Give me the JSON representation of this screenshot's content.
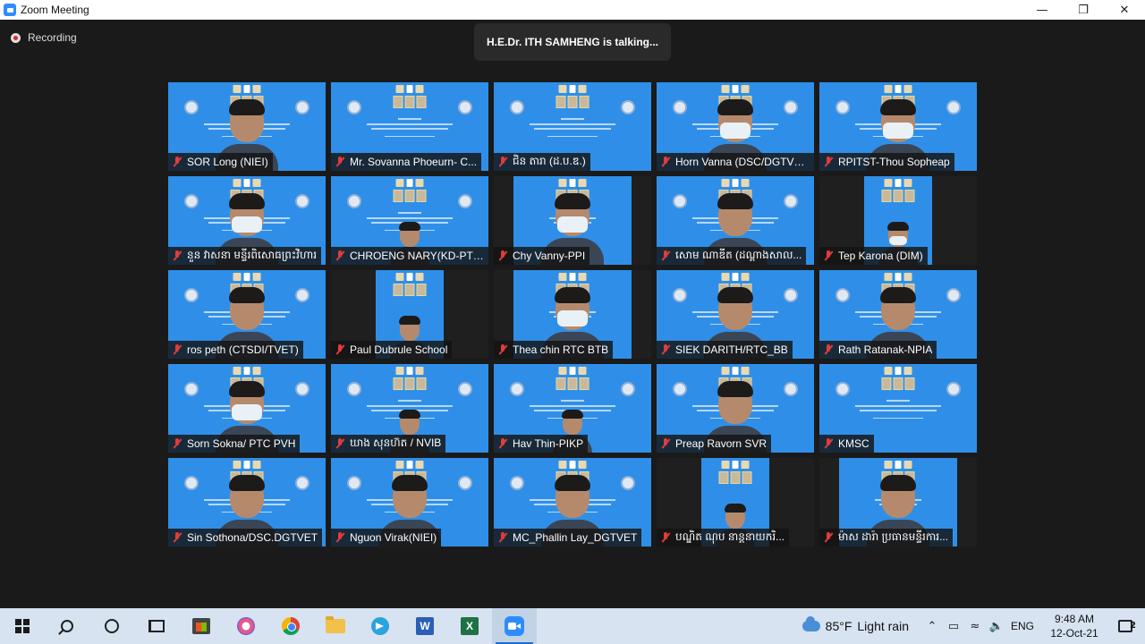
{
  "window": {
    "title": "Zoom Meeting",
    "controls": [
      "minimize-icon",
      "maximize-icon",
      "close-icon"
    ]
  },
  "recording": {
    "label": "Recording"
  },
  "speaker": {
    "text": "H.E.Dr. ITH SAMHENG is talking..."
  },
  "participants": [
    {
      "name": "SOR Long (NIEI)",
      "layout": "full",
      "person": "normal"
    },
    {
      "name": "Mr. Sovanna Phoeurn- C...",
      "layout": "full",
      "person": "none"
    },
    {
      "name": "ជិន តារា (ដ.ប.ឌ.)",
      "layout": "full",
      "person": "none"
    },
    {
      "name": "Horn Vanna (DSC/DGTVET)",
      "layout": "full",
      "person": "mask"
    },
    {
      "name": "RPITST-Thou Sopheap",
      "layout": "full",
      "person": "mask"
    },
    {
      "name": "នួន វាសនា មន្ទីរពិសោធព្រះវិហារ",
      "layout": "full",
      "person": "mask"
    },
    {
      "name": "CHROENG NARY(KD-PTC...",
      "layout": "full",
      "person": "small"
    },
    {
      "name": "Chy Vanny-PPI",
      "layout": "mid",
      "person": "mask"
    },
    {
      "name": "សោម ណាឌីត (ដណ្ដាងសាល...",
      "layout": "full",
      "person": "normal"
    },
    {
      "name": "Tep Karona (DIM)",
      "layout": "narrow",
      "person": "mask-small"
    },
    {
      "name": "ros peth (CTSDI/TVET)",
      "layout": "full",
      "person": "normal"
    },
    {
      "name": "Paul Dubrule School",
      "layout": "narrow",
      "person": "small"
    },
    {
      "name": "Thea chin RTC BTB",
      "layout": "mid",
      "person": "mask"
    },
    {
      "name": "SIEK DARITH/RTC_BB",
      "layout": "full",
      "person": "normal"
    },
    {
      "name": "Rath Ratanak-NPIA",
      "layout": "full",
      "person": "normal"
    },
    {
      "name": "Sorn Sokna/ PTC PVH",
      "layout": "full",
      "person": "mask"
    },
    {
      "name": "ឃាង សុនហ៊ត / NVIB",
      "layout": "full",
      "person": "small"
    },
    {
      "name": "Hav Thin-PIKP",
      "layout": "full",
      "person": "small"
    },
    {
      "name": "Preap Ravorn SVR",
      "layout": "full",
      "person": "normal"
    },
    {
      "name": "KMSC",
      "layout": "full",
      "person": "none"
    },
    {
      "name": "Sin Sothona/DSC.DGTVET",
      "layout": "full",
      "person": "normal"
    },
    {
      "name": "Nguon Virak(NIEI)",
      "layout": "full",
      "person": "normal"
    },
    {
      "name": "MC_Phallin Lay_DGTVET",
      "layout": "full",
      "person": "normal"
    },
    {
      "name": "បណ្ឌិត ណុប នាន្តនាយករិ...",
      "layout": "narrow",
      "person": "small"
    },
    {
      "name": "ម៉ាស ដារ៉ា ប្រធានមន្ទីរការ...",
      "layout": "mid",
      "person": "normal"
    }
  ],
  "taskbar": {
    "apps": [
      "windows-start-icon",
      "search-icon",
      "cortana-icon",
      "task-view-icon",
      "microsoft-store-icon",
      "snipping-tool-icon",
      "chrome-icon",
      "file-explorer-icon",
      "telegram-icon",
      "word-icon",
      "excel-icon",
      "zoom-icon"
    ],
    "word_letter": "W",
    "excel_letter": "X",
    "weather": {
      "temp": "85°F",
      "condition": "Light rain"
    },
    "language": "ENG",
    "time": "9:48 AM",
    "date": "12-Oct-21",
    "notification_count": "2"
  },
  "colors": {
    "accent": "#2d8cff",
    "slide_blue": "#2f8fe8",
    "mic_muted": "#e23b3b",
    "taskbar": "#d7e3f1"
  }
}
